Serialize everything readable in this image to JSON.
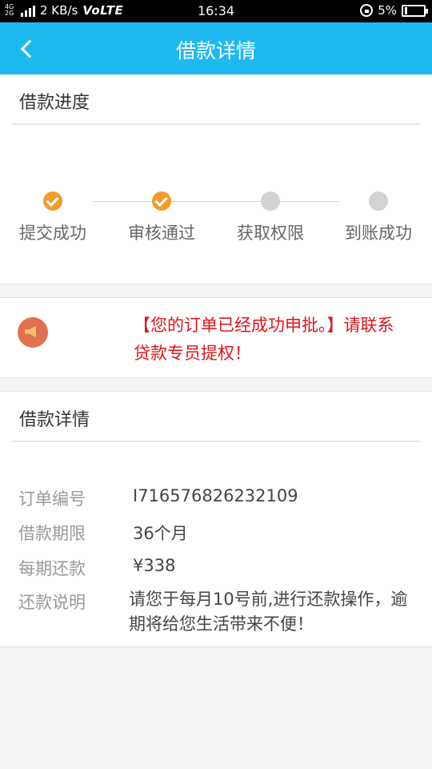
{
  "status_bar": {
    "network_small": "4G 2G",
    "speed": "2 KB/s",
    "volte": "VoLTE",
    "time": "16:34",
    "battery": "5%"
  },
  "header": {
    "title": "借款详情"
  },
  "progress": {
    "title": "借款进度",
    "steps": [
      {
        "label": "提交成功",
        "state": "done"
      },
      {
        "label": "审核通过",
        "state": "done"
      },
      {
        "label": "获取权限",
        "state": "pending"
      },
      {
        "label": "到账成功",
        "state": "pending"
      }
    ],
    "colors": {
      "done": "#f39c2c",
      "pending": "#d3d3d3"
    }
  },
  "notice": {
    "text": "【您的订单已经成功申批。】请联系贷款专员提权！",
    "icon": "megaphone-icon",
    "color": "#e0151b"
  },
  "details": {
    "title": "借款详情",
    "rows": [
      {
        "key": "订单编号",
        "value": "I716576826232109"
      },
      {
        "key": "借款期限",
        "value": "36个月"
      },
      {
        "key": "每期还款",
        "value": "¥338"
      },
      {
        "key": "还款说明",
        "value": "请您于每月10号前,进行还款操作，逾期将给您生活带来不便！"
      }
    ]
  },
  "accent": "#1fb9f2"
}
